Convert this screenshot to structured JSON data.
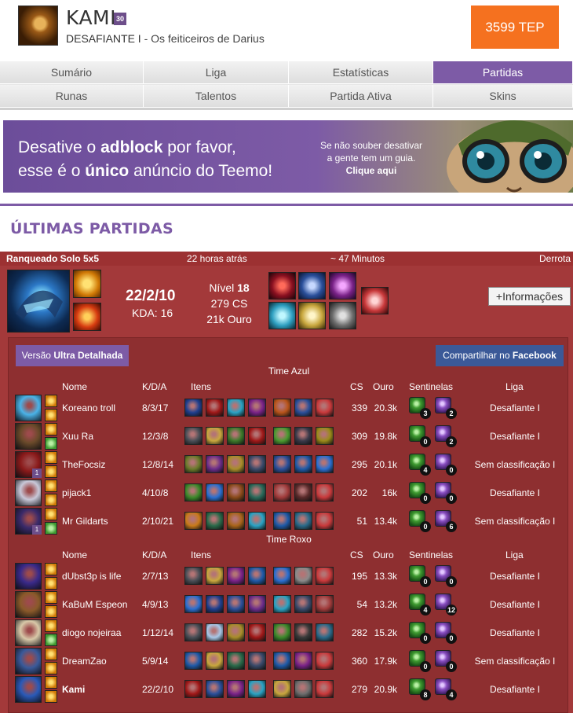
{
  "profile": {
    "name": "KAMI",
    "level": "30",
    "rank": "DESAFIANTE I",
    "rank_suffix": " - Os feiticeiros de Darius",
    "tep": "3599 TEP"
  },
  "tabs": {
    "row1": [
      "Sumário",
      "Liga",
      "Estatísticas",
      "Partidas"
    ],
    "row2": [
      "Runas",
      "Talentos",
      "Partida Ativa",
      "Skins"
    ],
    "active": "Partidas"
  },
  "banner": {
    "line1_a": "Desative o ",
    "line1_b": "adblock",
    "line1_c": " por favor,",
    "line2_a": "esse é o ",
    "line2_b": "único",
    "line2_c": " anúncio do Teemo!",
    "side1": "Se não souber desativar",
    "side2": "a gente tem um guia.",
    "side3": "Clique aqui"
  },
  "section_title": "ÚLTIMAS PARTIDAS",
  "match": {
    "queue": "Ranqueado Solo 5x5",
    "when": "22 horas atrás",
    "duration": "~ 47 Minutos",
    "result": "Derrota",
    "score": "22/2/10",
    "kda": "KDA: 16",
    "level_label": "Nível ",
    "level": "18",
    "cs": "279 CS",
    "gold": "21k Ouro",
    "info_button": "+Informações",
    "ultra_a": "Versão ",
    "ultra_b": "Ultra Detalhada",
    "fb_a": "Compartilhar no ",
    "fb_b": "Facebook"
  },
  "columns": [
    "Nome",
    "K/D/A",
    "Itens",
    "CS",
    "Ouro",
    "Sentinelas",
    "Liga"
  ],
  "teams": [
    {
      "title": "Time Azul",
      "players": [
        {
          "name": "Koreano troll",
          "kda": "8/3/17",
          "cs": "339",
          "gold": "20.3k",
          "ward_green": "3",
          "ward_pink": "2",
          "league": "Desafiante I",
          "level_badge": ""
        },
        {
          "name": "Xuu Ra",
          "kda": "12/3/8",
          "cs": "309",
          "gold": "19.8k",
          "ward_green": "0",
          "ward_pink": "2",
          "league": "Desafiante I",
          "level_badge": ""
        },
        {
          "name": "TheFocsiz",
          "kda": "12/8/14",
          "cs": "295",
          "gold": "20.1k",
          "ward_green": "4",
          "ward_pink": "0",
          "league": "Sem classificação I",
          "level_badge": "1"
        },
        {
          "name": "pijack1",
          "kda": "4/10/8",
          "cs": "202",
          "gold": "16k",
          "ward_green": "0",
          "ward_pink": "0",
          "league": "Desafiante I",
          "level_badge": ""
        },
        {
          "name": "Mr Gildarts",
          "kda": "2/10/21",
          "cs": "51",
          "gold": "13.4k",
          "ward_green": "0",
          "ward_pink": "6",
          "league": "Sem classificação I",
          "level_badge": "1"
        }
      ]
    },
    {
      "title": "Time Roxo",
      "players": [
        {
          "name": "dUbst3p is life",
          "kda": "2/7/13",
          "cs": "195",
          "gold": "13.3k",
          "ward_green": "0",
          "ward_pink": "0",
          "league": "Desafiante I",
          "level_badge": ""
        },
        {
          "name": "KaBuM Espeon",
          "kda": "4/9/13",
          "cs": "54",
          "gold": "13.2k",
          "ward_green": "4",
          "ward_pink": "12",
          "league": "Desafiante I",
          "level_badge": ""
        },
        {
          "name": "diogo nojeiraa",
          "kda": "1/12/14",
          "cs": "282",
          "gold": "15.2k",
          "ward_green": "0",
          "ward_pink": "0",
          "league": "Desafiante I",
          "level_badge": ""
        },
        {
          "name": "DreamZao",
          "kda": "5/9/14",
          "cs": "360",
          "gold": "17.9k",
          "ward_green": "0",
          "ward_pink": "0",
          "league": "Sem classificação I",
          "level_badge": ""
        },
        {
          "name": "Kami",
          "kda": "22/2/10",
          "cs": "279",
          "gold": "20.9k",
          "ward_green": "8",
          "ward_pink": "4",
          "league": "Desafiante I",
          "level_badge": "",
          "highlight": true
        }
      ]
    }
  ],
  "colors": {
    "purple": "#7d5ba6",
    "orange": "#f5711f",
    "defeat_red": "#a3393a",
    "facebook": "#3b5998"
  }
}
